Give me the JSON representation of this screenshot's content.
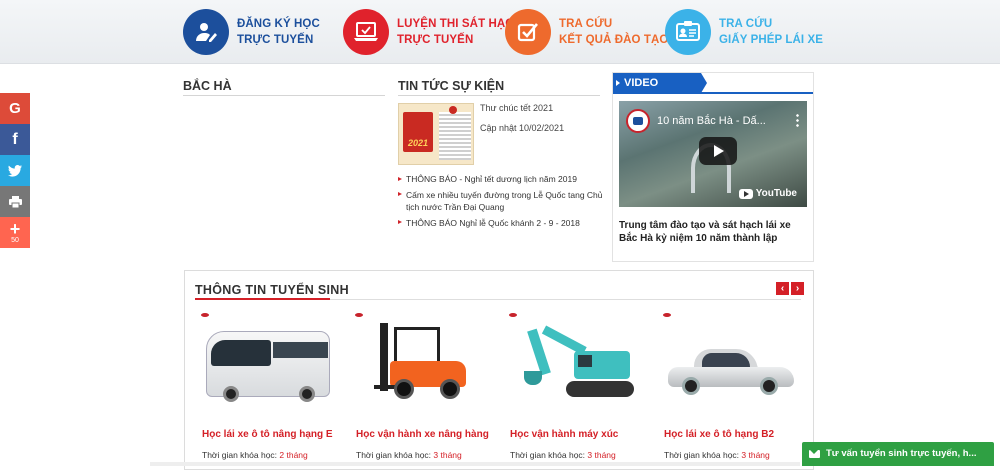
{
  "services": [
    {
      "line1": "ĐĂNG KÝ HỌC",
      "line2": "TRỰC TUYẾN",
      "icon": "user-pen-icon",
      "color": "#1c4f9c"
    },
    {
      "line1": "LUYỆN THI SÁT HẠCH",
      "line2": "TRỰC TUYẾN",
      "icon": "laptop-icon",
      "color": "#e0222c"
    },
    {
      "line1": "TRA CỨU",
      "line2": "KẾT QUẢ ĐÀO TẠO",
      "icon": "checkbox-icon",
      "color": "#ee6a2d"
    },
    {
      "line1": "TRA CỨU",
      "line2": "GIẤY PHÉP LÁI XE",
      "icon": "id-card-icon",
      "color": "#3bb2e8"
    }
  ],
  "social": {
    "google": "G",
    "facebook": "f",
    "plus": "+",
    "count": "50"
  },
  "bacha": {
    "title": "BẮC HÀ"
  },
  "news": {
    "title": "TIN TỨC SỰ KIỆN",
    "featured": {
      "headline": "Thư chúc tết 2021",
      "date": "Cập nhật 10/02/2021",
      "thumb_year": "2021"
    },
    "items": [
      "THÔNG BÁO - Nghỉ tết dương lịch năm 2019",
      "Cấm xe nhiều tuyến đường trong Lễ Quốc tang Chủ tịch nước Trần Đại Quang",
      "THÔNG BÁO Nghỉ lễ Quốc khánh 2 - 9 - 2018"
    ]
  },
  "video": {
    "tab": "VIDEO",
    "player_title": "10 năm Bắc Hà - Dấ...",
    "brand": "YouTube",
    "caption": "Trung tâm đào tạo và sát hạch lái xe Bắc Hà kỷ niệm 10 năm thành lập"
  },
  "admission": {
    "title": "THÔNG TIN TUYỂN SINH",
    "prev": "‹",
    "next": "›",
    "duration_label": "Thời gian khóa học: ",
    "cards": [
      {
        "name": "Học lái xe ô tô nâng hạng E",
        "duration": "2 tháng",
        "vehicle": "bus"
      },
      {
        "name": "Học vận hành xe nâng hàng",
        "duration": "3 tháng",
        "vehicle": "forklift"
      },
      {
        "name": "Học vận hành máy xúc",
        "duration": "3 tháng",
        "vehicle": "excavator"
      },
      {
        "name": "Học lái xe ô tô hạng B2",
        "duration": "3 tháng",
        "vehicle": "car"
      }
    ]
  },
  "chat": {
    "label": "Tư vấn tuyển sinh trực tuyến, h..."
  }
}
